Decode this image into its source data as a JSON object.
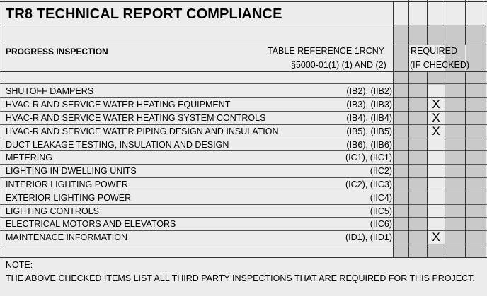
{
  "title": "TR8 TECHNICAL REPORT COMPLIANCE",
  "header": {
    "section_label": "PROGRESS INSPECTION",
    "table_reference_line1": "TABLE REFERENCE 1RCNY",
    "table_reference_line2": "§5000-01(1) (1) AND (2)",
    "required_line1": "REQUIRED",
    "required_line2": "(IF CHECKED)"
  },
  "rows": [
    {
      "label": "SHUTOFF DAMPERS",
      "code": "(IB2), (IIB2)",
      "checked": ""
    },
    {
      "label": "HVAC-R AND SERVICE WATER HEATING EQUIPMENT",
      "code": "(IB3), (IIB3)",
      "checked": "X"
    },
    {
      "label": "HVAC-R AND SERVICE WATER HEATING SYSTEM CONTROLS",
      "code": "(IB4), (IIB4)",
      "checked": "X"
    },
    {
      "label": "HVAC-R AND SERVICE WATER PIPING DESIGN AND INSULATION",
      "code": "(IB5), (IIB5)",
      "checked": "X"
    },
    {
      "label": "DUCT LEAKAGE TESTING, INSULATION AND DESIGN",
      "code": "(IB6), (IIB6)",
      "checked": ""
    },
    {
      "label": "METERING",
      "code": "(IC1), (IIC1)",
      "checked": ""
    },
    {
      "label": "LIGHTING IN DWELLING UNITS",
      "code": "(IIC2)",
      "checked": ""
    },
    {
      "label": "INTERIOR LIGHTING POWER",
      "code": "(IC2), (IIC3)",
      "checked": ""
    },
    {
      "label": "EXTERIOR LIGHTING POWER",
      "code": "(IIC4)",
      "checked": ""
    },
    {
      "label": "LIGHTING CONTROLS",
      "code": "(IIC5)",
      "checked": ""
    },
    {
      "label": "ELECTRICAL MOTORS AND ELEVATORS",
      "code": "(IIC6)",
      "checked": ""
    },
    {
      "label": "MAINTENACE INFORMATION",
      "code": "(ID1), (IID1)",
      "checked": "X"
    }
  ],
  "note": {
    "label": "NOTE:",
    "text": "THE ABOVE CHECKED ITEMS LIST ALL THIRD PARTY INSPECTIONS THAT ARE REQUIRED FOR THIS PROJECT."
  }
}
